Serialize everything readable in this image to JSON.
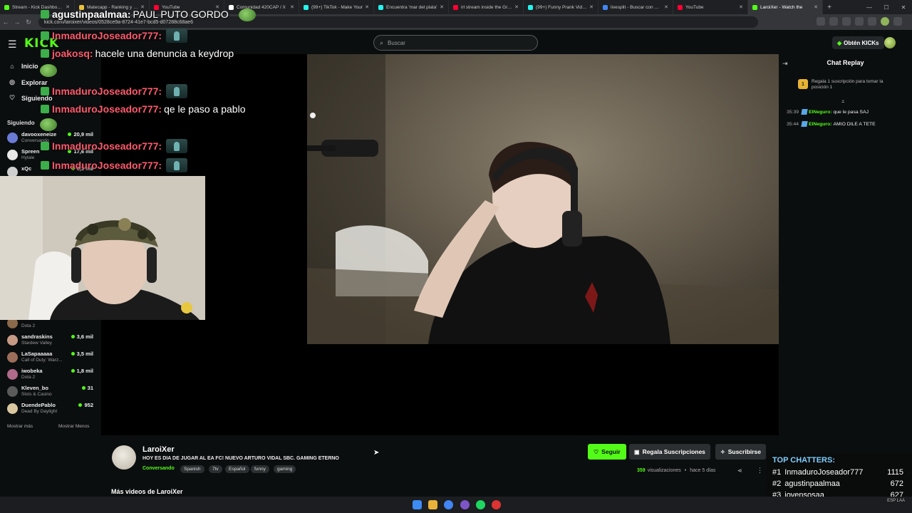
{
  "browser": {
    "tabs": [
      {
        "label": "Stream - Kick Dashboard",
        "color": "#53fc18"
      },
      {
        "label": "Matecapp - Ranking y Ra",
        "color": "#e8c23a"
      },
      {
        "label": "YouTube",
        "color": "#ff0033"
      },
      {
        "label": "Comunidad 420CAP / X",
        "color": "#ffffff"
      },
      {
        "label": "(99+) TikTok - Make Your",
        "color": "#25f4ee"
      },
      {
        "label": "Encuentra 'mar del plata'",
        "color": "#25f4ee"
      },
      {
        "label": "irl stream inside the Great",
        "color": "#ff0033"
      },
      {
        "label": "(99+) Funny Prank Videos",
        "color": "#25f4ee"
      },
      {
        "label": "livesplit - Buscar con Goo",
        "color": "#4285f4"
      },
      {
        "label": "YouTube",
        "color": "#ff0033"
      },
      {
        "label": "LaroiXer - Watch the",
        "color": "#53fc18",
        "active": true
      }
    ],
    "url": "kick.com/laroixer/videos/0528ce9a-8724-41e7-bcd5-d07288c68ae6"
  },
  "header": {
    "logo": "KICK",
    "search_placeholder": "Buscar",
    "kicks_label": "Obtén KICKs"
  },
  "sidebar": {
    "nav": [
      {
        "label": "Inicio",
        "icon": "home-icon"
      },
      {
        "label": "Explorar",
        "icon": "compass-icon"
      },
      {
        "label": "Siguiendo",
        "icon": "heart-icon"
      }
    ],
    "following_title": "Siguiendo",
    "channels_top": [
      {
        "name": "davooxeneize",
        "game": "Conversando",
        "viewers": "20,9 mil",
        "color": "#6a7bd6"
      },
      {
        "name": "Spreen",
        "game": "Hytale",
        "viewers": "17,6 mil",
        "color": "#e8e8e8"
      },
      {
        "name": "xQc",
        "game": "",
        "viewers": "6,3 mil",
        "color": "#cfcfcf"
      }
    ],
    "channels_bottom": [
      {
        "name": "",
        "game": "Dota 2",
        "viewers": "",
        "color": "#8a6a4a"
      },
      {
        "name": "sandraskins",
        "game": "Stardew Valley",
        "viewers": "3,6 mil",
        "color": "#c79a86"
      },
      {
        "name": "LaSapaaaaa",
        "game": "Call of Duty: Warz...",
        "viewers": "3,5 mil",
        "color": "#9c6d5a"
      },
      {
        "name": "iwobeka",
        "game": "Dota 2",
        "viewers": "1,8 mil",
        "color": "#b06a8a"
      },
      {
        "name": "Kleven_bo",
        "game": "Slots & Casino",
        "viewers": "31",
        "color": "#5a5a5a"
      },
      {
        "name": "DuendePablo",
        "game": "Dead By Daylight",
        "viewers": "952",
        "color": "#d9c7a0"
      }
    ],
    "show_more": "Mostrar más",
    "show_less": "Mostrar Menos"
  },
  "overlay_chat": [
    {
      "user": "agustinpaalmaa:",
      "message": "PAUL PUTO GORDO",
      "style": "white"
    },
    {
      "user": "InmaduroJoseador777:",
      "message": "",
      "style": "red",
      "emote": true
    },
    {
      "user": "joakosq:",
      "message": "hacele una denuncia a keydrop",
      "style": "red"
    },
    {
      "user": "InmaduroJoseador777:",
      "message": "",
      "style": "red",
      "emote": true
    },
    {
      "user": "InmaduroJoseador777:",
      "message": "qe le paso a pablo",
      "style": "red"
    },
    {
      "user": "InmaduroJoseador777:",
      "message": "",
      "style": "red",
      "emote": true
    },
    {
      "user": "InmaduroJoseador777:",
      "message": "",
      "style": "red",
      "emote": true
    }
  ],
  "chat_replay": {
    "title": "Chat Replay",
    "gift_rank": "1",
    "gift_text": "Regala 1 suscripción para tomar la posición 1",
    "messages": [
      {
        "time": "35:39",
        "user": "ElNeguro:",
        "text": "que le pasa SAJ"
      },
      {
        "time": "35:44",
        "user": "ElNeguro:",
        "text": "AMIO DILE A TETE"
      }
    ]
  },
  "stream": {
    "name": "LaroiXer",
    "title": "HOY ES DIA DE JUGAR AL EA FC! NUEVO ARTURO VIDAL SBC. GAMING ETERNO",
    "category": "Conversando",
    "tags": [
      "Spanish",
      "7tv",
      "Español",
      "funny",
      "gaming"
    ],
    "follow_label": "Seguir",
    "gift_label": "Regala Suscripciones",
    "subscribe_label": "Suscribirse",
    "views_number": "359",
    "views_label": "visualizaciones",
    "time_ago": "hace 5 días",
    "more_videos": "Más videos de LaroiXer"
  },
  "top_chatters": {
    "title": "TOP CHATTERS:",
    "rows": [
      {
        "rank": "#1",
        "name": "InmaduroJoseador777",
        "count": "1115"
      },
      {
        "rank": "#2",
        "name": "agustinpaalmaa",
        "count": "672"
      },
      {
        "rank": "#3",
        "name": "jovensosaa",
        "count": "627"
      }
    ]
  },
  "taskbar": {
    "lang": "ESP LAA"
  }
}
